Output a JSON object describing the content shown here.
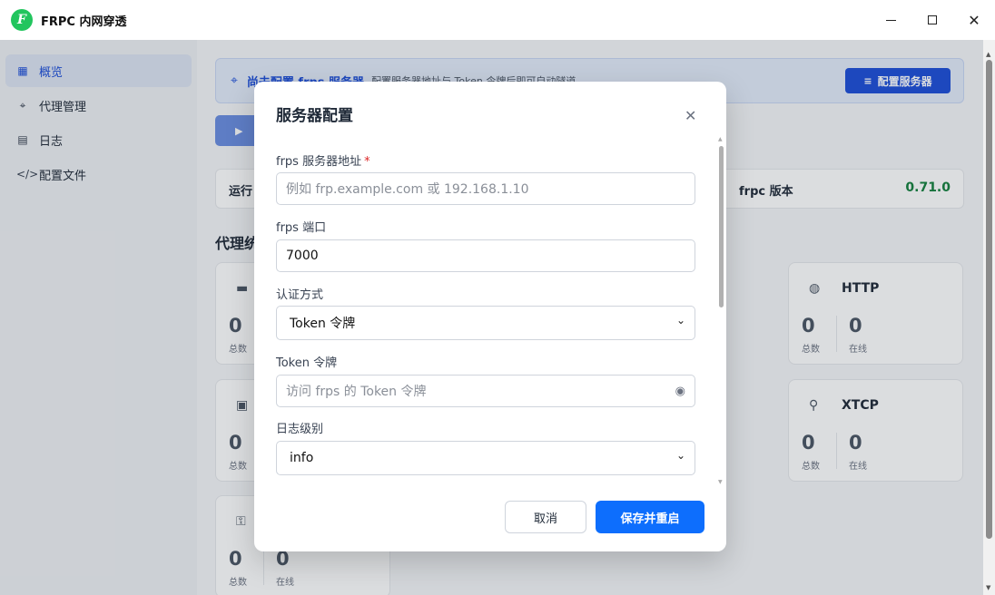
{
  "window": {
    "title": "FRPC 内网穿透",
    "logo_letter": "F",
    "minimize_icon": "minimize-icon",
    "maximize_icon": "maximize-icon",
    "close_glyph": "✕"
  },
  "sidebar": {
    "items": [
      {
        "label": "概览",
        "icon": "grid-icon",
        "glyph": "▦",
        "active": true
      },
      {
        "label": "代理管理",
        "icon": "network-icon",
        "glyph": "⌖",
        "active": false
      },
      {
        "label": "日志",
        "icon": "document-icon",
        "glyph": "▤",
        "active": false
      },
      {
        "label": "配置文件",
        "icon": "code-icon",
        "glyph": "</>",
        "active": false
      }
    ]
  },
  "main": {
    "banner": {
      "icon": "network-icon",
      "glyph": "⌖",
      "title": "尚未配置 frps 服务器",
      "desc": "配置服务器地址与 Token 令牌后即可自动隧道",
      "button_label": "配置服务器",
      "button_glyph": "≡"
    },
    "start_button_glyph": "▶",
    "info_row": {
      "left_label": "运行",
      "right_label": "frpc 版本",
      "right_value": "0.71.0"
    },
    "section_title": "代理统",
    "cards": [
      {
        "title": "",
        "icon": "server-icon",
        "glyph": "▬",
        "count": "0",
        "sub": "总数",
        "count2": "",
        "sub2": ""
      },
      {
        "title": "HTTP",
        "icon": "globe-icon",
        "glyph": "◍",
        "count": "0",
        "sub": "总数",
        "count2": "0",
        "sub2": "在线"
      },
      {
        "title": "",
        "icon": "lock-icon",
        "glyph": "▣",
        "count": "0",
        "sub": "总数",
        "count2": "",
        "sub2": ""
      },
      {
        "title": "XTCP",
        "icon": "share-icon",
        "glyph": "⚲",
        "count": "0",
        "sub": "总数",
        "count2": "0",
        "sub2": "在线"
      },
      {
        "title": "",
        "icon": "key-icon",
        "glyph": "⚿",
        "count": "0",
        "sub": "总数",
        "count2": "0",
        "sub2": "在线"
      }
    ]
  },
  "dialog": {
    "title": "服务器配置",
    "close_glyph": "✕",
    "fields": {
      "server_addr_label": "frps 服务器地址",
      "server_addr_required": "*",
      "server_addr_placeholder": "例如 frp.example.com 或 192.168.1.10",
      "port_label": "frps 端口",
      "port_value": "7000",
      "auth_label": "认证方式",
      "auth_value": "Token 令牌",
      "token_label": "Token 令牌",
      "token_placeholder": "访问 frps 的 Token 令牌",
      "log_label": "日志级别",
      "log_value": "info"
    },
    "cancel_label": "取消",
    "save_label": "保存并重启"
  }
}
